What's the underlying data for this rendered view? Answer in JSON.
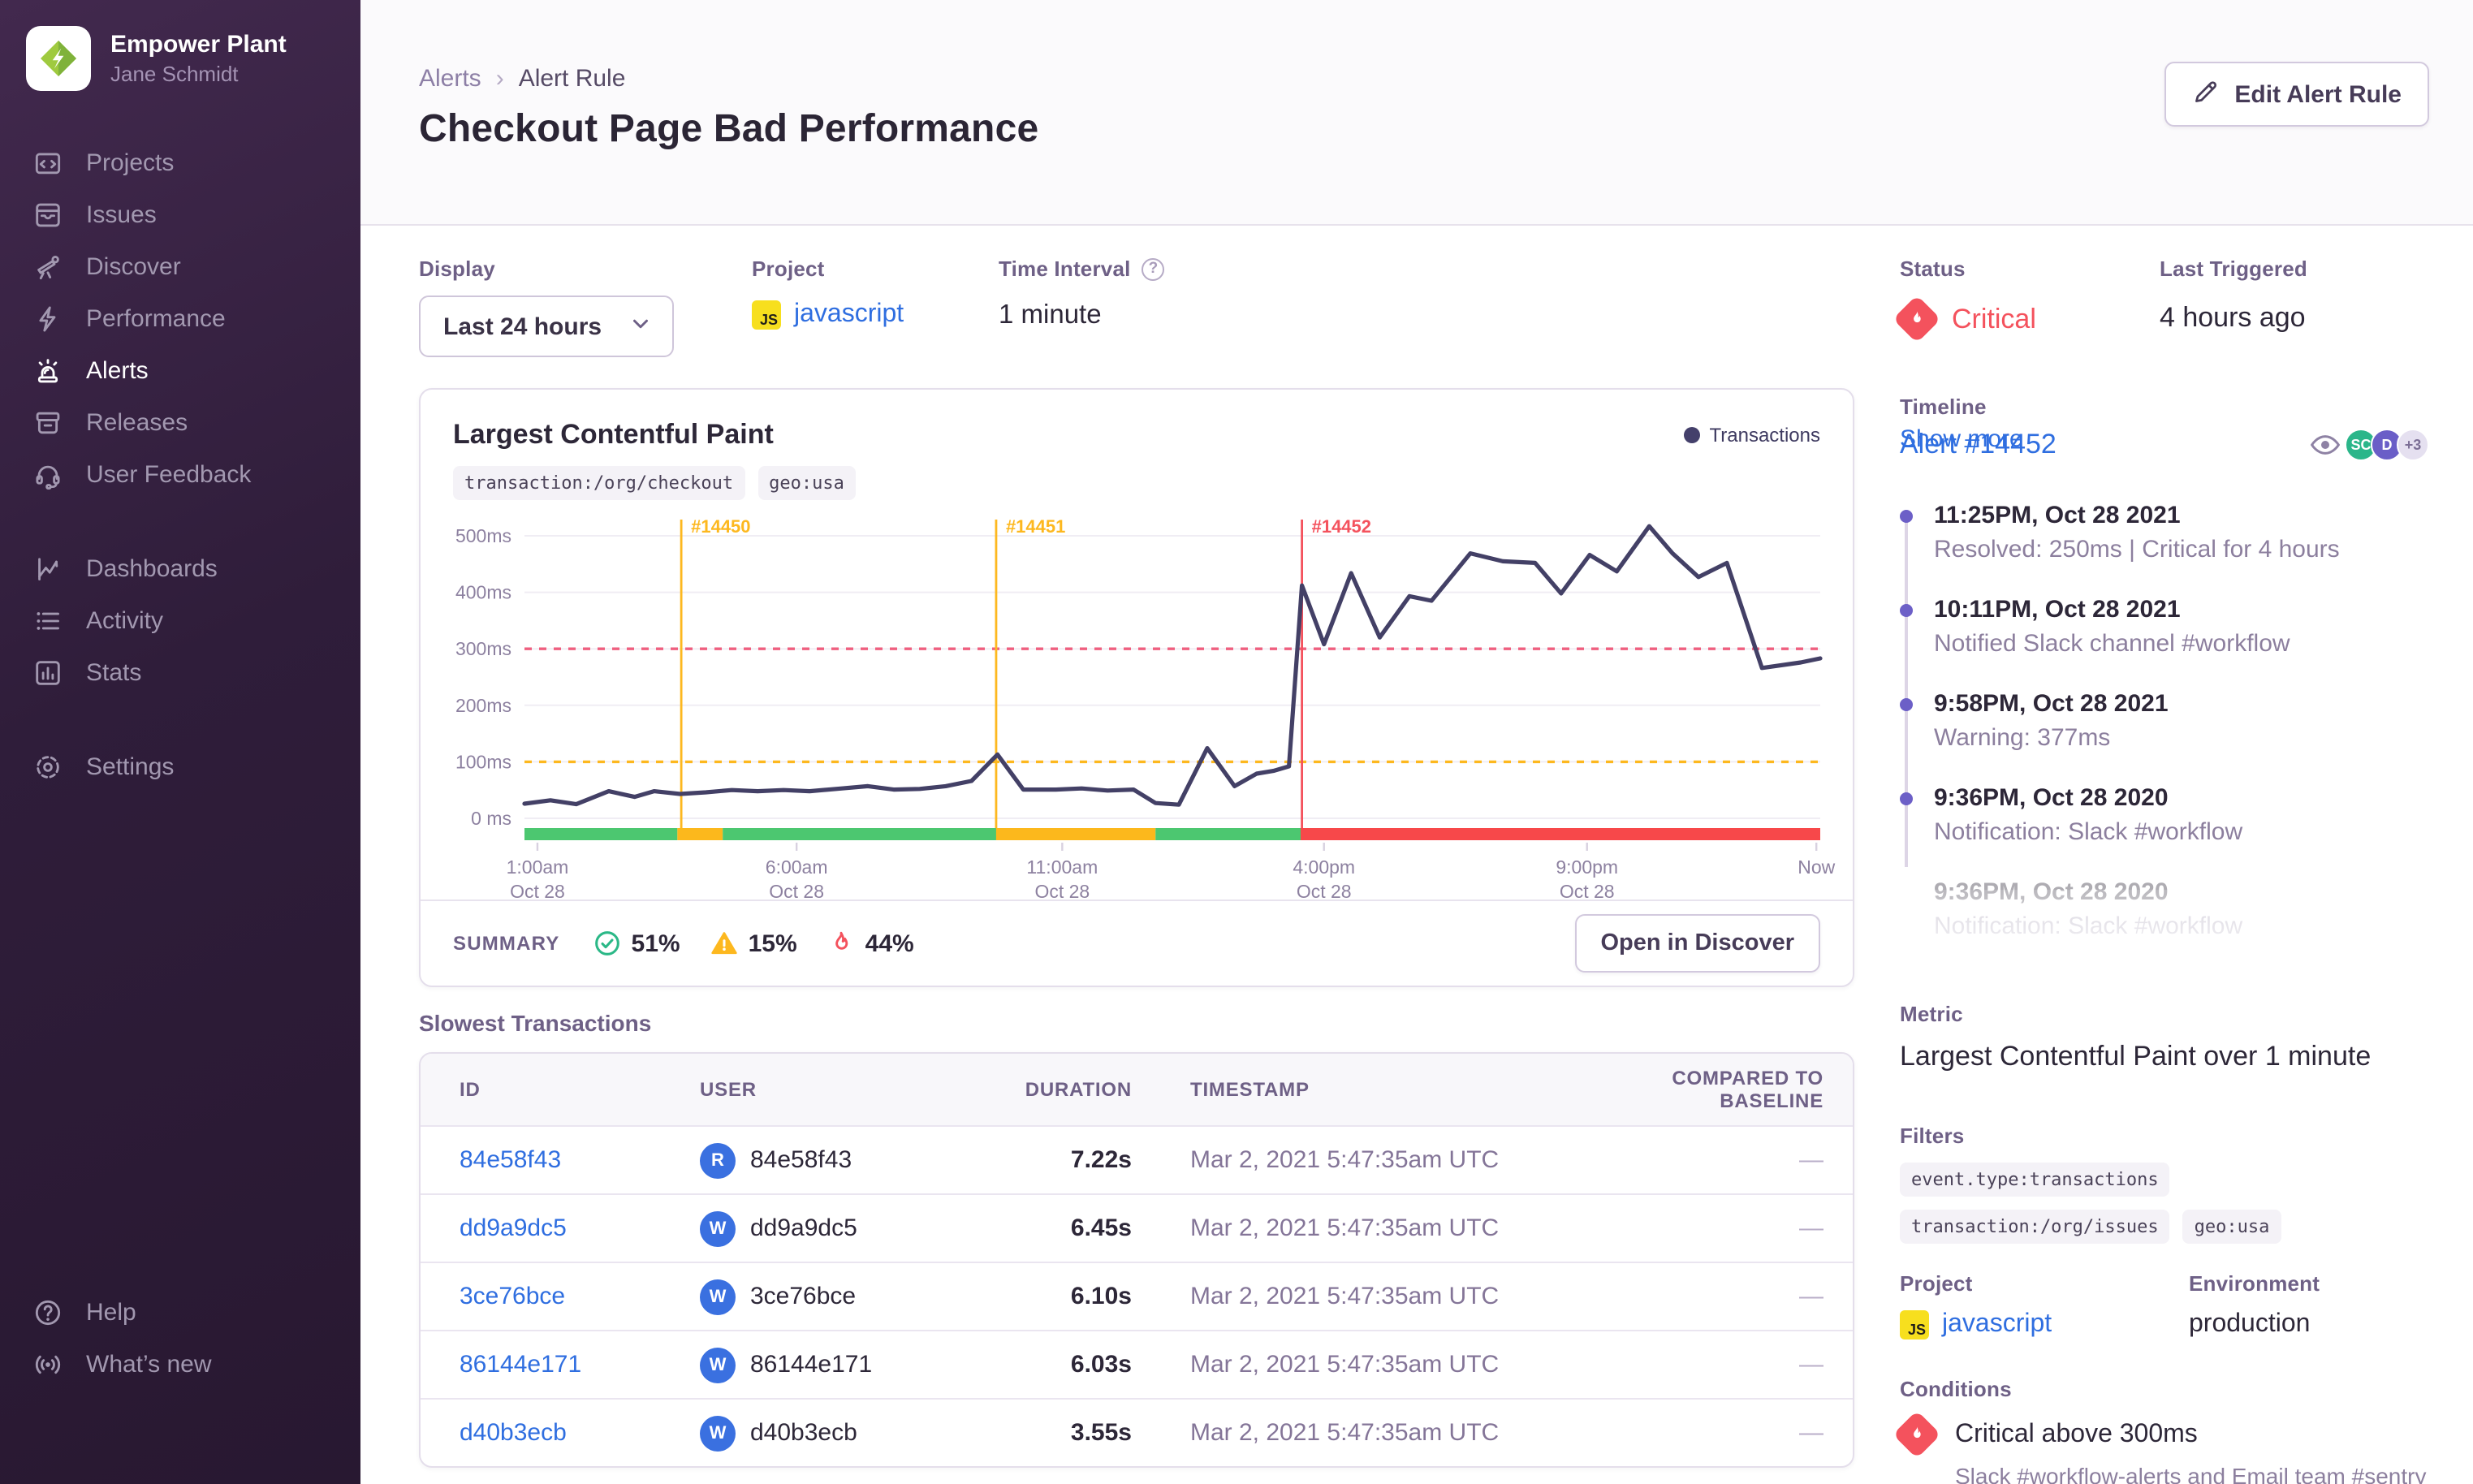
{
  "sidebar": {
    "org": "Empower Plant",
    "user": "Jane Schmidt",
    "active": "Alerts",
    "groups": [
      {
        "items": [
          {
            "icon": "projects",
            "label": "Projects"
          },
          {
            "icon": "issues",
            "label": "Issues"
          },
          {
            "icon": "discover",
            "label": "Discover"
          },
          {
            "icon": "performance",
            "label": "Performance"
          },
          {
            "icon": "alerts",
            "label": "Alerts"
          },
          {
            "icon": "releases",
            "label": "Releases"
          },
          {
            "icon": "user-feedback",
            "label": "User Feedback"
          }
        ]
      },
      {
        "items": [
          {
            "icon": "dashboards",
            "label": "Dashboards"
          },
          {
            "icon": "activity",
            "label": "Activity"
          },
          {
            "icon": "stats",
            "label": "Stats"
          }
        ]
      },
      {
        "items": [
          {
            "icon": "settings",
            "label": "Settings"
          }
        ]
      }
    ],
    "bottom": [
      {
        "icon": "help",
        "label": "Help"
      },
      {
        "icon": "whats-new",
        "label": "What’s new"
      }
    ]
  },
  "header": {
    "breadcrumb": {
      "parent": "Alerts",
      "current": "Alert Rule"
    },
    "title": "Checkout Page Bad Performance",
    "edit_button": "Edit Alert Rule"
  },
  "filters_bar": {
    "display_label": "Display",
    "display_value": "Last 24 hours",
    "project_label": "Project",
    "project_value": "javascript",
    "interval_label": "Time Interval",
    "interval_help": "?",
    "interval_value": "1 minute"
  },
  "status_panel": {
    "status_label": "Status",
    "status_value": "Critical",
    "last_triggered_label": "Last Triggered",
    "last_triggered_value": "4 hours ago"
  },
  "chart_card": {
    "title": "Largest Contentful Paint",
    "tags": [
      "transaction:/org/checkout",
      "geo:usa"
    ],
    "legend": "Transactions",
    "summary_label": "SUMMARY",
    "summary": [
      {
        "icon": "check",
        "value": "51%"
      },
      {
        "icon": "warning",
        "value": "15%"
      },
      {
        "icon": "fire",
        "value": "44%"
      }
    ],
    "button": "Open in Discover"
  },
  "chart_data": {
    "type": "line",
    "title": "Largest Contentful Paint",
    "unit": "ms",
    "ylim": [
      0,
      500
    ],
    "yticks": [
      {
        "v": 0,
        "label": "0 ms"
      },
      {
        "v": 100,
        "label": "100ms"
      },
      {
        "v": 200,
        "label": "200ms"
      },
      {
        "v": 300,
        "label": "300ms"
      },
      {
        "v": 400,
        "label": "400ms"
      },
      {
        "v": 500,
        "label": "500ms"
      }
    ],
    "xticks": [
      {
        "x": 0.01,
        "top": "1:00am",
        "bottom": "Oct 28"
      },
      {
        "x": 0.21,
        "top": "6:00am",
        "bottom": "Oct 28"
      },
      {
        "x": 0.415,
        "top": "11:00am",
        "bottom": "Oct 28"
      },
      {
        "x": 0.617,
        "top": "4:00pm",
        "bottom": "Oct 28"
      },
      {
        "x": 0.82,
        "top": "9:00pm",
        "bottom": "Oct 28"
      },
      {
        "x": 0.997,
        "top": "Now",
        "bottom": ""
      }
    ],
    "series": [
      {
        "name": "Transactions",
        "color": "#434066",
        "points": [
          [
            0.0,
            26
          ],
          [
            0.02,
            32
          ],
          [
            0.04,
            25
          ],
          [
            0.065,
            48
          ],
          [
            0.085,
            38
          ],
          [
            0.1,
            48
          ],
          [
            0.12,
            43
          ],
          [
            0.14,
            46
          ],
          [
            0.16,
            50
          ],
          [
            0.18,
            48
          ],
          [
            0.2,
            50
          ],
          [
            0.22,
            48
          ],
          [
            0.245,
            53
          ],
          [
            0.265,
            57
          ],
          [
            0.285,
            51
          ],
          [
            0.305,
            52
          ],
          [
            0.325,
            57
          ],
          [
            0.345,
            66
          ],
          [
            0.365,
            113
          ],
          [
            0.385,
            51
          ],
          [
            0.41,
            51
          ],
          [
            0.43,
            53
          ],
          [
            0.45,
            49
          ],
          [
            0.47,
            51
          ],
          [
            0.487,
            27
          ],
          [
            0.505,
            24
          ],
          [
            0.527,
            124
          ],
          [
            0.548,
            57
          ],
          [
            0.565,
            79
          ],
          [
            0.578,
            84
          ],
          [
            0.59,
            92
          ],
          [
            0.6,
            412
          ],
          [
            0.617,
            308
          ],
          [
            0.638,
            434
          ],
          [
            0.66,
            320
          ],
          [
            0.683,
            393
          ],
          [
            0.7,
            385
          ],
          [
            0.73,
            469
          ],
          [
            0.755,
            455
          ],
          [
            0.78,
            452
          ],
          [
            0.8,
            398
          ],
          [
            0.822,
            466
          ],
          [
            0.843,
            437
          ],
          [
            0.868,
            517
          ],
          [
            0.886,
            469
          ],
          [
            0.906,
            427
          ],
          [
            0.928,
            452
          ],
          [
            0.955,
            266
          ],
          [
            0.985,
            276
          ],
          [
            1.0,
            283
          ]
        ]
      }
    ],
    "thresholds": [
      {
        "value": 300,
        "color": "#ef5f7f",
        "label": "critical threshold"
      },
      {
        "value": 100,
        "color": "#fdb81f",
        "label": "warning threshold"
      }
    ],
    "events": [
      {
        "label": "#14450",
        "x": 0.121,
        "color": "#fdb81f"
      },
      {
        "label": "#14451",
        "x": 0.364,
        "color": "#fdb81f"
      },
      {
        "label": "#14452",
        "x": 0.6,
        "color": "#f4525d"
      }
    ],
    "status_segments": [
      {
        "from": 0,
        "to": 0.118,
        "status": "ok"
      },
      {
        "from": 0.118,
        "to": 0.153,
        "status": "warning"
      },
      {
        "from": 0.153,
        "to": 0.364,
        "status": "ok"
      },
      {
        "from": 0.364,
        "to": 0.487,
        "status": "warning"
      },
      {
        "from": 0.487,
        "to": 0.599,
        "status": "ok"
      },
      {
        "from": 0.599,
        "to": 1.0,
        "status": "critical"
      }
    ],
    "status_colors": {
      "ok": "#4cc770",
      "warning": "#fcb81c",
      "critical": "#f7484a"
    },
    "grid": true,
    "legend_position": "top-right"
  },
  "table": {
    "heading": "Slowest Transactions",
    "columns": [
      "ID",
      "USER",
      "DURATION",
      "",
      "TIMESTAMP",
      "COMPARED TO BASELINE"
    ],
    "rows": [
      {
        "id": "84e58f43",
        "avatar": "R",
        "user": "84e58f43",
        "duration": "7.22s",
        "timestamp": "Mar 2, 2021 5:47:35am UTC",
        "baseline": "—"
      },
      {
        "id": "dd9a9dc5",
        "avatar": "W",
        "user": "dd9a9dc5",
        "duration": "6.45s",
        "timestamp": "Mar 2, 2021 5:47:35am UTC",
        "baseline": "—"
      },
      {
        "id": "3ce76bce",
        "avatar": "W",
        "user": "3ce76bce",
        "duration": "6.10s",
        "timestamp": "Mar 2, 2021 5:47:35am UTC",
        "baseline": "—"
      },
      {
        "id": "86144e171",
        "avatar": "W",
        "user": "86144e171",
        "duration": "6.03s",
        "timestamp": "Mar 2, 2021 5:47:35am UTC",
        "baseline": "—"
      },
      {
        "id": "d40b3ecb",
        "avatar": "W",
        "user": "d40b3ecb",
        "duration": "3.55s",
        "timestamp": "Mar 2, 2021 5:47:35am UTC",
        "baseline": "—"
      }
    ]
  },
  "timeline": {
    "label": "Timeline",
    "alert_link": "Alert #14452",
    "avatars": {
      "eye_icon": "eye-icon",
      "badges": [
        {
          "text": "SC",
          "bg": "#2bb68a",
          "fg": "#ffffff"
        },
        {
          "text": "D",
          "bg": "#6a5ec7",
          "fg": "#ffffff"
        },
        {
          "text": "+3",
          "bg": "#e5e0f0",
          "fg": "#7c6f96"
        }
      ]
    },
    "entries": [
      {
        "time": "11:25PM, Oct 28 2021",
        "desc": "Resolved: 250ms | Critical for 4 hours",
        "faded": false
      },
      {
        "time": "10:11PM, Oct 28 2021",
        "desc": "Notified Slack channel #workflow",
        "faded": false
      },
      {
        "time": "9:58PM, Oct 28 2021",
        "desc": "Warning: 377ms",
        "faded": false
      },
      {
        "time": "9:36PM, Oct 28 2020",
        "desc": "Notification: Slack #workflow",
        "faded": false
      },
      {
        "time": "9:36PM, Oct 28 2020",
        "desc": "Notification: Slack #workflow",
        "faded": true
      }
    ],
    "show_more": "Show more"
  },
  "details": {
    "metric_label": "Metric",
    "metric_value": "Largest Contentful Paint over 1 minute",
    "filters_label": "Filters",
    "filter_tags": [
      "event.type:transactions",
      "transaction:/org/issues",
      "geo:usa"
    ],
    "project_label": "Project",
    "project_value": "javascript",
    "environment_label": "Environment",
    "environment_value": "production",
    "conditions_label": "Conditions",
    "condition_title": "Critical above 300ms",
    "condition_sub": "Slack #workflow-alerts and Email team #sentry"
  },
  "colors": {
    "critical": "#f4525d",
    "warning": "#fdb81f",
    "ok": "#4cc770",
    "link": "#2f6ee0",
    "series": "#434066"
  }
}
